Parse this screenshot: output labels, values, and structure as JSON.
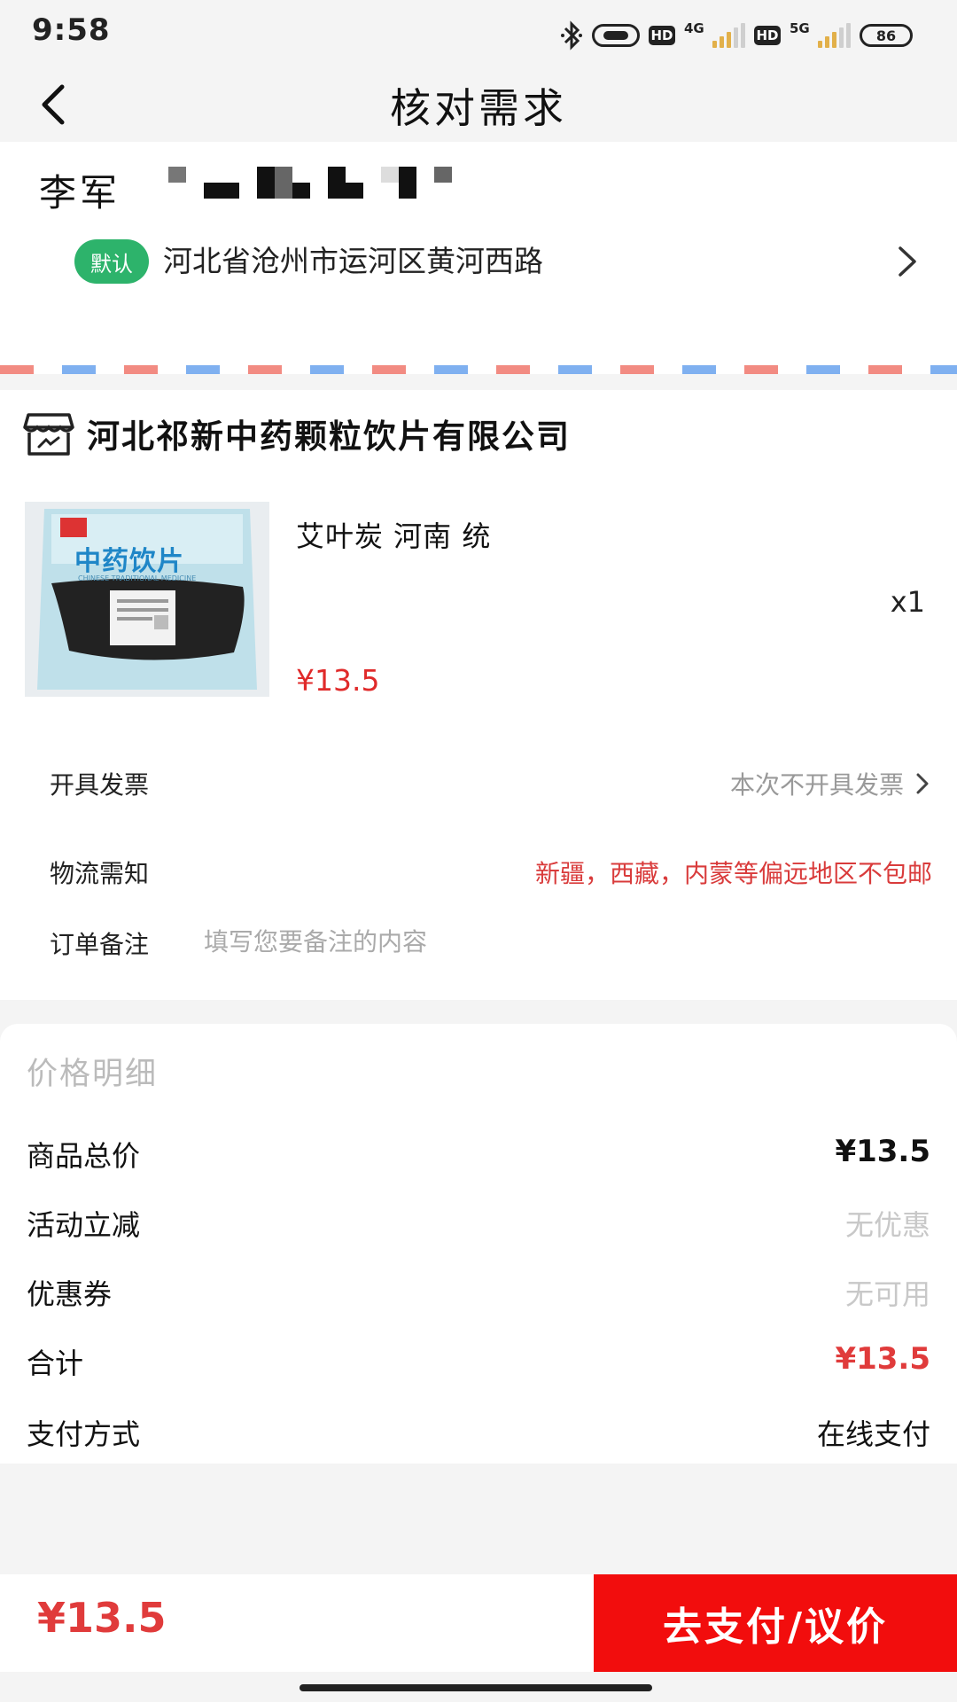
{
  "status_bar": {
    "time": "9:58",
    "hd1": "HD",
    "net1": "4G",
    "hd2": "HD",
    "net2": "5G",
    "battery": "86"
  },
  "header": {
    "title": "核对需求"
  },
  "address": {
    "name": "李军",
    "default_badge": "默认",
    "text": "河北省沧州市运河区黄河西路"
  },
  "order": {
    "shop_name": "河北祁新中药颗粒饮片有限公司",
    "product": {
      "name": "艾叶炭 河南 统",
      "quantity": "x1",
      "price": "¥13.5",
      "image_label": "中药饮片",
      "image_sublabel": "CHINESE TRADITIONAL MEDICINE"
    },
    "invoice": {
      "label": "开具发票",
      "value": "本次不开具发票"
    },
    "logistics": {
      "label": "物流需知",
      "value": "新疆，西藏，内蒙等偏远地区不包邮"
    },
    "remark": {
      "label": "订单备注",
      "placeholder": "填写您要备注的内容"
    }
  },
  "price_detail": {
    "title": "价格明细",
    "rows": [
      {
        "label": "商品总价",
        "value": "¥13.5"
      },
      {
        "label": "活动立减",
        "value": "无优惠"
      },
      {
        "label": "优惠券",
        "value": "无可用"
      },
      {
        "label": "合计",
        "value": "¥13.5"
      },
      {
        "label": "支付方式",
        "value": "在线支付"
      }
    ]
  },
  "bottom": {
    "total": "¥13.5",
    "pay_label": "去支付/议价"
  },
  "colors": {
    "accent_red": "#f20d0d",
    "price_red": "#e03b3b",
    "default_badge_green": "#2db36b"
  }
}
